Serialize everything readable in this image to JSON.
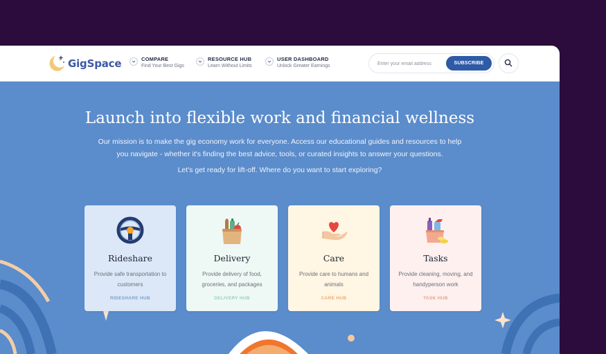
{
  "brand": {
    "name": "GigSpace"
  },
  "nav": [
    {
      "title": "COMPARE",
      "subtitle": "Find Your Best Gigs"
    },
    {
      "title": "RESOURCE HUB",
      "subtitle": "Learn Without Limits"
    },
    {
      "title": "USER DASHBOARD",
      "subtitle": "Unlock Greater Earnings"
    }
  ],
  "subscribe": {
    "placeholder": "Enter your email address",
    "button_label": "SUBSCRIBE"
  },
  "hero": {
    "title": "Launch into flexible work and financial wellness",
    "description": "Our mission is to make the gig economy work for everyone. Access our educational guides and resources to help you navigate - whether it's finding the best advice, tools, or curated insights to answer your questions.",
    "prompt": "Let's get ready for lift-off. Where do you want to start exploring?"
  },
  "cards": [
    {
      "title": "Rideshare",
      "description": "Provide safe transportation to customers",
      "link": "RIDESHARE HUB",
      "icon": "steering-wheel-icon",
      "bg": "#dce8f7",
      "link_color": "#7f9fd2"
    },
    {
      "title": "Delivery",
      "description": "Provide delivery of food, groceries, and packages",
      "link": "DELIVERY HUB",
      "icon": "grocery-bag-icon",
      "bg": "#eef9f5",
      "link_color": "#9ad0bd"
    },
    {
      "title": "Care",
      "description": "Provide care to humans and animals",
      "link": "CARE HUB",
      "icon": "heart-hand-icon",
      "bg": "#fff6e3",
      "link_color": "#f0aa74"
    },
    {
      "title": "Tasks",
      "description": "Provide cleaning, moving, and handyperson work",
      "link": "TASK HUB",
      "icon": "cleaning-supplies-icon",
      "bg": "#fdf0ef",
      "link_color": "#e8a192"
    }
  ],
  "colors": {
    "frame": "#2b0c3c",
    "hero_bg": "#5b8ccb",
    "brand_blue": "#3d58a6",
    "subscribe_btn": "#2e5aa6"
  }
}
